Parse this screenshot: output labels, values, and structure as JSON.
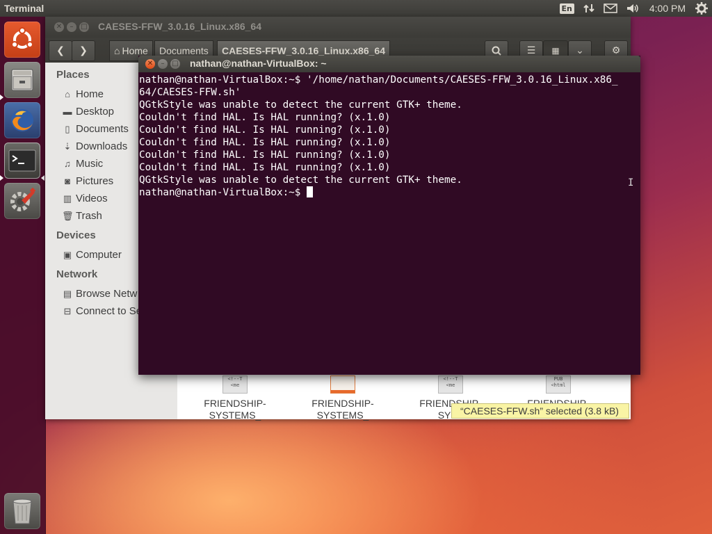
{
  "top_panel": {
    "app_title": "Terminal",
    "keyboard_layout": "En",
    "clock": "4:00 PM",
    "indicators": [
      "keyboard-layout-icon",
      "network-icon",
      "mail-icon",
      "volume-icon",
      "settings-gear-icon"
    ]
  },
  "launcher": {
    "items": [
      "ubuntu-dash-icon",
      "files-icon",
      "firefox-icon",
      "terminal-icon",
      "system-settings-icon"
    ],
    "trash": "trash-icon"
  },
  "file_manager": {
    "title": "CAESES-FFW_3.0.16_Linux.x86_64",
    "breadcrumbs": [
      "Home",
      "Documents",
      "CAESES-FFW_3.0.16_Linux.x86_64"
    ],
    "sidebar": {
      "places_heading": "Places",
      "places": [
        {
          "label": "Home",
          "icon": "home-icon"
        },
        {
          "label": "Desktop",
          "icon": "desktop-icon"
        },
        {
          "label": "Documents",
          "icon": "documents-icon"
        },
        {
          "label": "Downloads",
          "icon": "downloads-icon"
        },
        {
          "label": "Music",
          "icon": "music-icon"
        },
        {
          "label": "Pictures",
          "icon": "pictures-icon"
        },
        {
          "label": "Videos",
          "icon": "videos-icon"
        },
        {
          "label": "Trash",
          "icon": "trash-icon"
        }
      ],
      "devices_heading": "Devices",
      "devices": [
        {
          "label": "Computer",
          "icon": "computer-icon"
        }
      ],
      "network_heading": "Network",
      "network": [
        {
          "label": "Browse Netw",
          "icon": "network-icon"
        },
        {
          "label": "Connect to Se",
          "icon": "server-icon"
        }
      ]
    },
    "files": [
      {
        "line1": "FRIENDSHIP-",
        "line2": "SYSTEMS_",
        "icon_text": "<!--T\n<me"
      },
      {
        "line1": "FRIENDSHIP-",
        "line2": "SYSTEMS_",
        "icon_text": ""
      },
      {
        "line1": "FRIENDSHIP-",
        "line2": "SYST",
        "icon_text": "<!--T\n<me"
      },
      {
        "line1": "FRIENDSHIP-",
        "line2": "",
        "icon_text": "PUB\n<html"
      }
    ],
    "status_text": "“CAESES-FFW.sh” selected  (3.8 kB)"
  },
  "terminal": {
    "title": "nathan@nathan-VirtualBox: ~",
    "lines": [
      "nathan@nathan-VirtualBox:~$ '/home/nathan/Documents/CAESES-FFW_3.0.16_Linux.x86_",
      "64/CAESES-FFW.sh'",
      "QGtkStyle was unable to detect the current GTK+ theme.",
      "Couldn't find HAL. Is HAL running? (x.1.0)",
      "Couldn't find HAL. Is HAL running? (x.1.0)",
      "Couldn't find HAL. Is HAL running? (x.1.0)",
      "Couldn't find HAL. Is HAL running? (x.1.0)",
      "Couldn't find HAL. Is HAL running? (x.1.0)",
      "QGtkStyle was unable to detect the current GTK+ theme."
    ],
    "prompt": "nathan@nathan-VirtualBox:~$ "
  },
  "colors": {
    "terminal_bg": "#300a24",
    "panel_bg": "#3c3b37",
    "close_button": "#df4a16",
    "status_bg": "#f9f4a5"
  }
}
